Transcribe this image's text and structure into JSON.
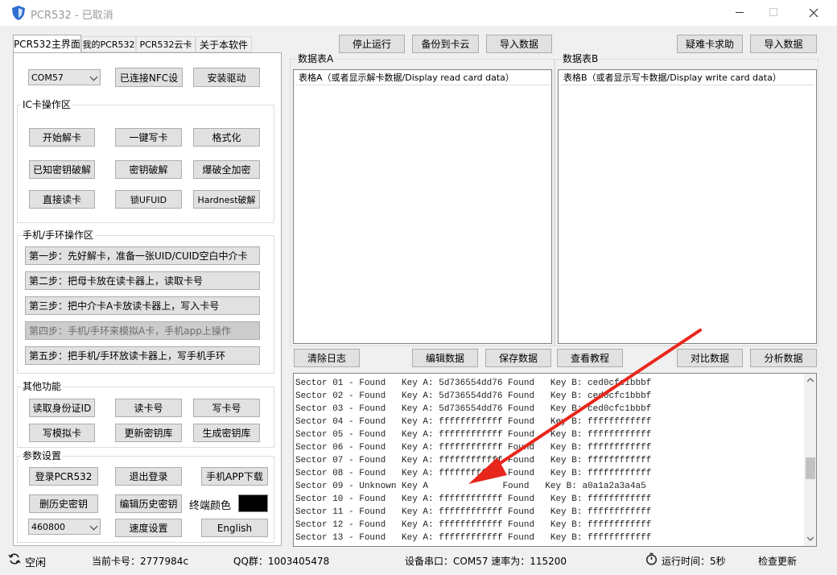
{
  "window": {
    "title": "PCR532 - 已取消"
  },
  "tabs": [
    {
      "label": "PCR532主界面"
    },
    {
      "label": "我的PCR532"
    },
    {
      "label": "PCR532云卡"
    },
    {
      "label": "关于本软件"
    }
  ],
  "top_toolbar": {
    "stop": "停止运行",
    "backup": "备份到卡云",
    "import1": "导入数据",
    "help": "疑难卡求助",
    "import2": "导入数据"
  },
  "connection": {
    "port_value": "COM57",
    "connected_btn": "已连接NFC设",
    "install_driver": "安装驱动"
  },
  "ic_group": {
    "title": "IC卡操作区",
    "buttons": [
      "开始解卡",
      "一键写卡",
      "格式化",
      "已知密钥破解",
      "密钥破解",
      "爆破全加密",
      "直接读卡",
      "锁UFUID",
      "Hardnest破解"
    ]
  },
  "phone_group": {
    "title": "手机/手环操作区",
    "steps": [
      "第一步：先好解卡，准备一张UID/CUID空白中介卡",
      "第二步：把母卡放在读卡器上，读取卡号",
      "第三步：把中介卡A卡放读卡器上，写入卡号",
      "第四步：手机/手环来模拟A卡，手机app上操作",
      "第五步：把手机/手环放读卡器上，写手机手环"
    ]
  },
  "other_group": {
    "title": "其他功能",
    "buttons": [
      "读取身份证ID",
      "读卡号",
      "写卡号",
      "写模拟卡",
      "更新密钥库",
      "生成密钥库"
    ]
  },
  "param_group": {
    "title": "参数设置",
    "login": "登录PCR532",
    "logout": "退出登录",
    "app_download": "手机APP下载",
    "delete_keys": "删历史密钥",
    "edit_keys": "编辑历史密钥",
    "terminal_color_label": "终端颜色",
    "terminal_color": "#000000",
    "baud_value": "460800",
    "speed": "速度设置",
    "language": "English"
  },
  "table_a": {
    "group_label": "数据表A",
    "header": "表格A（或者显示解卡数据/Display read card data）"
  },
  "table_b": {
    "group_label": "数据表B",
    "header": "表格B（或者显示写卡数据/Display write card data）"
  },
  "mid_toolbar": {
    "clear_log": "清除日志",
    "edit_data": "编辑数据",
    "save_data": "保存数据",
    "tutorial": "查看教程",
    "compare": "对比数据",
    "analyze": "分析数据"
  },
  "log_lines": [
    "Sector 01 - Found   Key A: 5d736554dd76 Found   Key B: ced0cfc1bbbf",
    "Sector 02 - Found   Key A: 5d736554dd76 Found   Key B: ced0cfc1bbbf",
    "Sector 03 - Found   Key A: 5d736554dd76 Found   Key B: ced0cfc1bbbf",
    "Sector 04 - Found   Key A: ffffffffffff Found   Key B: ffffffffffff",
    "Sector 05 - Found   Key A: ffffffffffff Found   Key B: ffffffffffff",
    "Sector 06 - Found   Key A: ffffffffffff Found   Key B: ffffffffffff",
    "Sector 07 - Found   Key A: ffffffffffff Found   Key B: ffffffffffff",
    "Sector 08 - Found   Key A: ffffffffffff Found   Key B: ffffffffffff",
    "Sector 09 - Unknown Key A              Found   Key B: a0a1a2a3a4a5",
    "Sector 10 - Found   Key A: ffffffffffff Found   Key B: ffffffffffff",
    "Sector 11 - Found   Key A: ffffffffffff Found   Key B: ffffffffffff",
    "Sector 12 - Found   Key A: ffffffffffff Found   Key B: ffffffffffff",
    "Sector 13 - Found   Key A: ffffffffffff Found   Key B: ffffffffffff"
  ],
  "status": {
    "idle": "空闲",
    "card_no": "当前卡号：2777984c",
    "qq": "QQ群：1003405478",
    "port": "设备串口：COM57  速率为：115200",
    "runtime": "运行时间：5秒",
    "update": "检查更新"
  },
  "colors": {
    "arrow": "#e8261c"
  },
  "icons": {
    "app": "shield-icon",
    "status": "refresh-icon",
    "timer": "stopwatch-icon"
  }
}
